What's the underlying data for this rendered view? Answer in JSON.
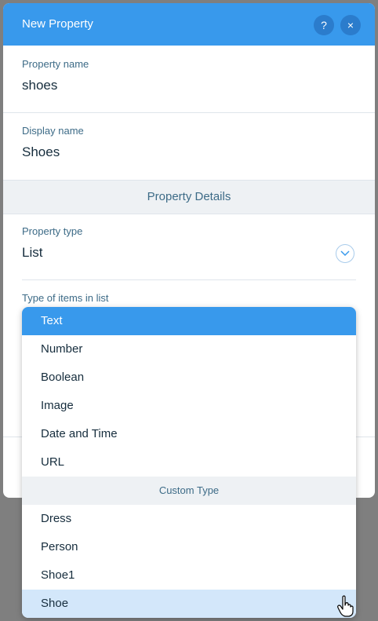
{
  "header": {
    "title": "New Property",
    "help_label": "?",
    "close_label": "×"
  },
  "property_name": {
    "label": "Property name",
    "value": "shoes"
  },
  "display_name": {
    "label": "Display name",
    "value": "Shoes"
  },
  "section": {
    "title": "Property Details"
  },
  "property_type": {
    "label": "Property type",
    "value": "List"
  },
  "items_type": {
    "label": "Type of items in list"
  },
  "dropdown": {
    "basic_items": [
      "Text",
      "Number",
      "Boolean",
      "Image",
      "Date and Time",
      "URL"
    ],
    "group_label": "Custom Type",
    "custom_items": [
      "Dress",
      "Person",
      "Shoe1",
      "Shoe"
    ],
    "selected": "Text",
    "hovered": "Shoe"
  },
  "colors": {
    "accent": "#3899ec",
    "hover": "#d3e7fa",
    "overlay": "#7f7f7f"
  },
  "icons": {
    "help": "help-icon",
    "close": "close-icon",
    "chevron": "chevron-down-icon",
    "cursor": "hand-pointer-icon"
  }
}
